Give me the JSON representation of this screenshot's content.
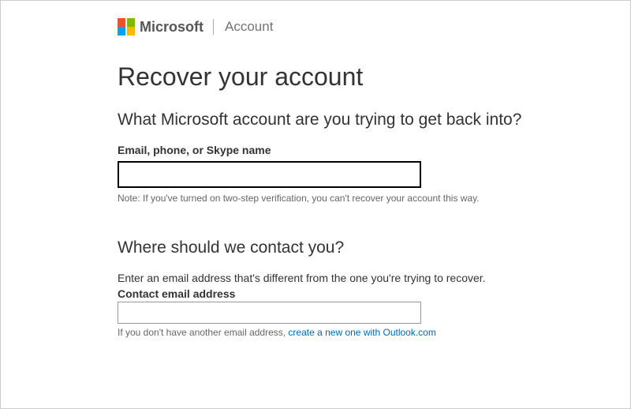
{
  "header": {
    "brand": "Microsoft",
    "section": "Account"
  },
  "page": {
    "heading": "Recover your account",
    "subheading1": "What Microsoft account are you trying to get back into?",
    "identifier_label": "Email, phone, or Skype name",
    "identifier_value": "",
    "note": "Note: If you've turned on two-step verification, you can't recover your account this way.",
    "subheading2": "Where should we contact you?",
    "contact_help": "Enter an email address that's different from the one you're trying to recover.",
    "contact_label": "Contact email address",
    "contact_value": "",
    "no_email_prefix": "If you don't have another email address, ",
    "outlook_link": "create a new one with Outlook.com"
  }
}
